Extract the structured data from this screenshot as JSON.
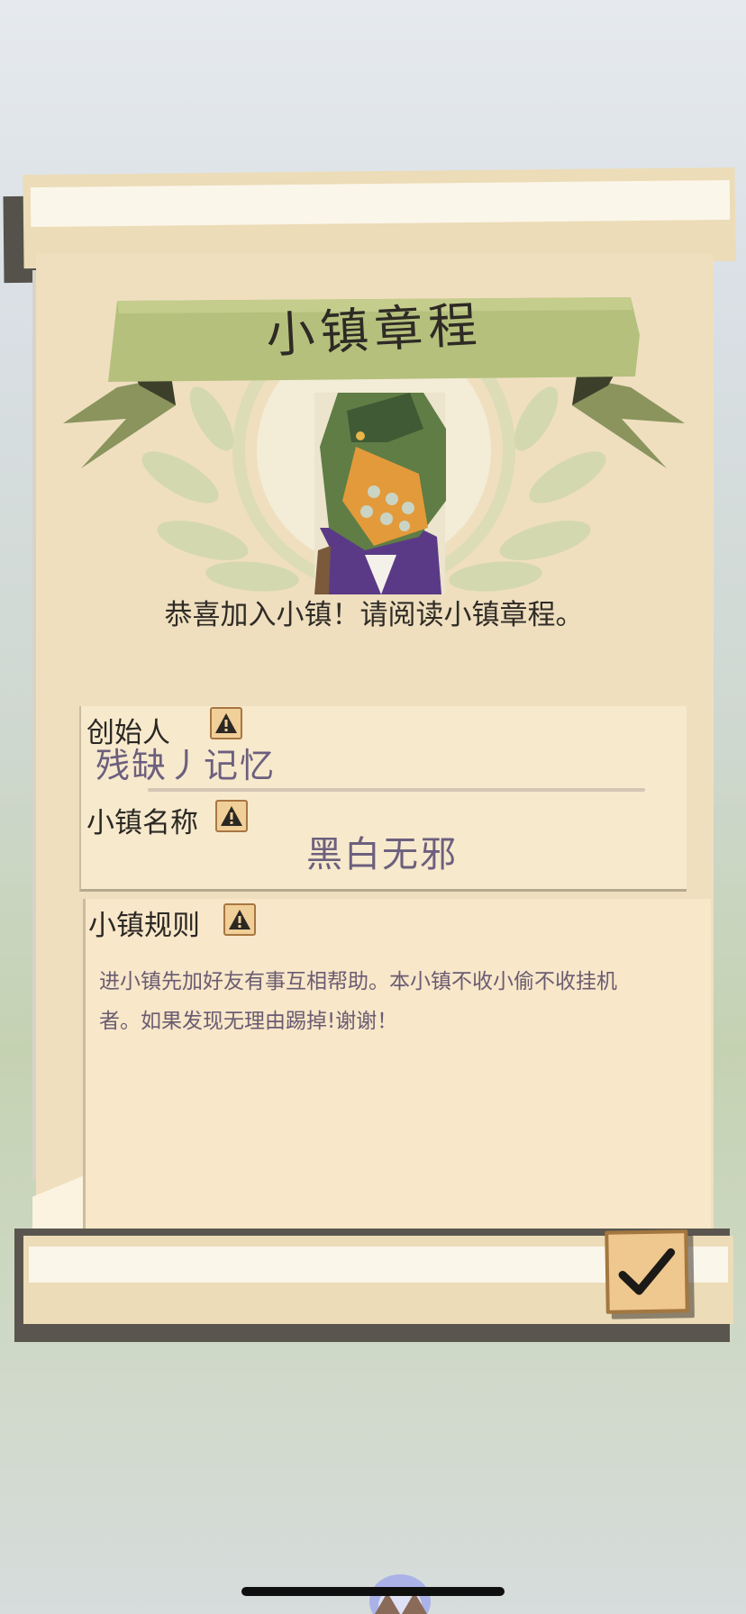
{
  "screen": {
    "title": "小镇章程",
    "welcome": "恭喜加入小镇！请阅读小镇章程。"
  },
  "fields": {
    "founder": {
      "label": "创始人",
      "value": "残缺丿记忆"
    },
    "town_name": {
      "label": "小镇名称",
      "value": "黑白无邪"
    },
    "rules": {
      "label": "小镇规则",
      "value": "进小镇先加好友有事互相帮助。本小镇不收小偷不收挂机者。如果发现无理由踢掉!谢谢！"
    }
  },
  "icons": {
    "warning": "warning-icon",
    "confirm": "checkmark-icon",
    "emblem": "laurel-wreath-icon",
    "avatar": "dinosaur-avatar"
  },
  "colors": {
    "parchment": "#efdfbf",
    "banner": "#b7c27b",
    "value_text": "#6c5f7e",
    "confirm_fill": "#eec88f"
  }
}
